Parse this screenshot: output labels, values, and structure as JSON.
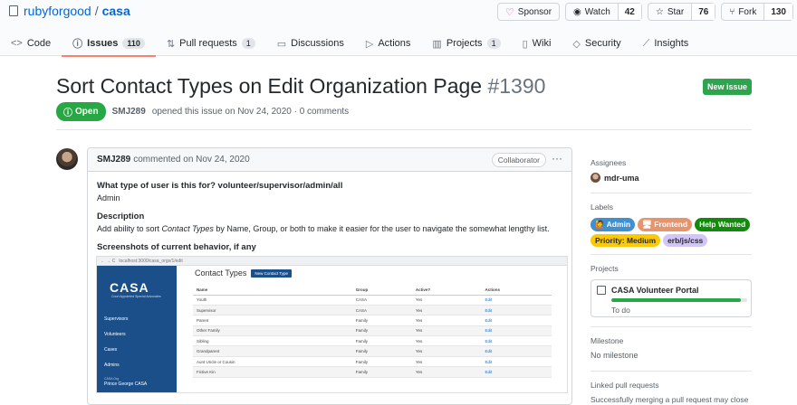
{
  "repo": {
    "owner": "rubyforgood",
    "separator": "/",
    "name": "casa"
  },
  "header_actions": {
    "sponsor": "Sponsor",
    "watch": {
      "label": "Watch",
      "count": "42"
    },
    "star": {
      "label": "Star",
      "count": "76"
    },
    "fork": {
      "label": "Fork",
      "count": "130"
    }
  },
  "tabs": [
    {
      "label": "Code",
      "icon": "code-icon"
    },
    {
      "label": "Issues",
      "icon": "issue-icon",
      "badge": "110"
    },
    {
      "label": "Pull requests",
      "icon": "pull-request-icon",
      "badge": "1"
    },
    {
      "label": "Discussions",
      "icon": "discussion-icon"
    },
    {
      "label": "Actions",
      "icon": "play-icon"
    },
    {
      "label": "Projects",
      "icon": "project-icon",
      "badge": "1"
    },
    {
      "label": "Wiki",
      "icon": "book-icon"
    },
    {
      "label": "Security",
      "icon": "shield-icon"
    },
    {
      "label": "Insights",
      "icon": "graph-icon"
    }
  ],
  "issue": {
    "title": "Sort Contact Types on Edit Organization Page",
    "number": "#1390",
    "state": "Open",
    "author": "SMJ289",
    "meta": "opened this issue on Nov 24, 2020 · 0 comments",
    "new_issue": "New issue"
  },
  "comment": {
    "author": "SMJ289",
    "time": "commented on Nov 24, 2020",
    "role": "Collaborator",
    "more": "···",
    "q1": "What type of user is this for? volunteer/supervisor/admin/all",
    "a1": "Admin",
    "q2": "Description",
    "a2_before": "Add ability to sort ",
    "a2_em": "Contact Types",
    "a2_after": " by Name, Group, or both to make it easier for the user to navigate the somewhat lengthy list.",
    "q3": "Screenshots of current behavior, if any"
  },
  "screenshot": {
    "url": "localhost:3000/casa_orgs/1/edit",
    "logo": "CASA",
    "logo_sub": "Court Appointed Special Advocates",
    "nav": [
      "Supervisors",
      "Volunteers",
      "Cases",
      "Admins"
    ],
    "org_label": "CASA Org",
    "org_name": "Prince George CASA",
    "title": "Contact Types",
    "new_btn": "New Contact Type",
    "columns": [
      "Name",
      "Group",
      "Active?",
      "Actions"
    ],
    "rows": [
      [
        "Youth",
        "CASA",
        "Yes",
        "Edit"
      ],
      [
        "Supervisor",
        "CASA",
        "Yes",
        "Edit"
      ],
      [
        "Parent",
        "Family",
        "Yes",
        "Edit"
      ],
      [
        "Other Family",
        "Family",
        "Yes",
        "Edit"
      ],
      [
        "Sibling",
        "Family",
        "Yes",
        "Edit"
      ],
      [
        "Grandparent",
        "Family",
        "Yes",
        "Edit"
      ],
      [
        "Aunt Uncle or Cousin",
        "Family",
        "Yes",
        "Edit"
      ],
      [
        "Fictive Kin",
        "Family",
        "Yes",
        "Edit"
      ]
    ]
  },
  "sidebar": {
    "assignees_h": "Assignees",
    "assignee": "mdr-uma",
    "labels_h": "Labels",
    "labels": [
      {
        "text": "🙋 Admin",
        "bg": "#3f8fd1",
        "fg": "#ffffff"
      },
      {
        "text": "🖥 Frontend",
        "bg": "#e6946d",
        "fg": "#ffffff"
      },
      {
        "text": "Help Wanted",
        "bg": "#128a0c",
        "fg": "#ffffff"
      },
      {
        "text": "Priority: Medium",
        "bg": "#fbca04",
        "fg": "#24292e"
      },
      {
        "text": "erb/js/css",
        "bg": "#d4c5f9",
        "fg": "#24292e"
      }
    ],
    "projects_h": "Projects",
    "project_name": "CASA Volunteer Portal",
    "project_progress": 0.95,
    "project_status": "To do",
    "milestone_h": "Milestone",
    "milestone": "No milestone",
    "linked_h": "Linked pull requests",
    "linked_text": "Successfully merging a pull request may close"
  }
}
